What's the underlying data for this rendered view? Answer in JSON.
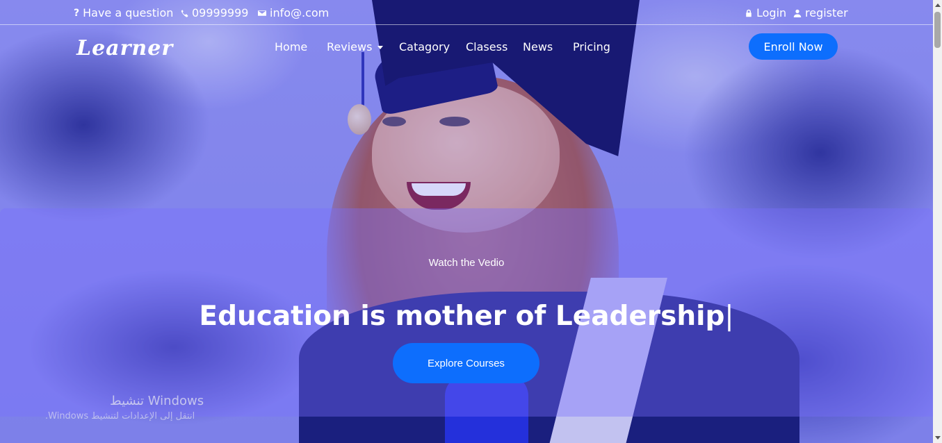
{
  "topbar": {
    "question": "Have a question",
    "phone": "09999999",
    "email": "info@.com",
    "login": "Login",
    "register": "register"
  },
  "brand": {
    "logo": "Learner"
  },
  "nav": {
    "home": "Home",
    "reviews": "Reviews",
    "category": "Catagory",
    "classes": "Clasess",
    "news": "News",
    "pricing": "Pricing",
    "enroll": "Enroll Now"
  },
  "hero": {
    "subtitle": "Watch the Vedio",
    "title": "Education is mother of Leadership",
    "cursor": "|",
    "cta": "Explore Courses"
  },
  "watermark": {
    "line1": "تنشيط Windows",
    "line2": "انتقل إلى الإعدادات لتنشيط Windows."
  },
  "colors": {
    "accent": "#0d6efd",
    "overlay": "#7b6eff",
    "capNavy": "#0c0c52"
  },
  "icons": [
    "question-icon",
    "phone-icon",
    "envelope-icon",
    "lock-icon",
    "user-icon",
    "caret-down-icon"
  ]
}
